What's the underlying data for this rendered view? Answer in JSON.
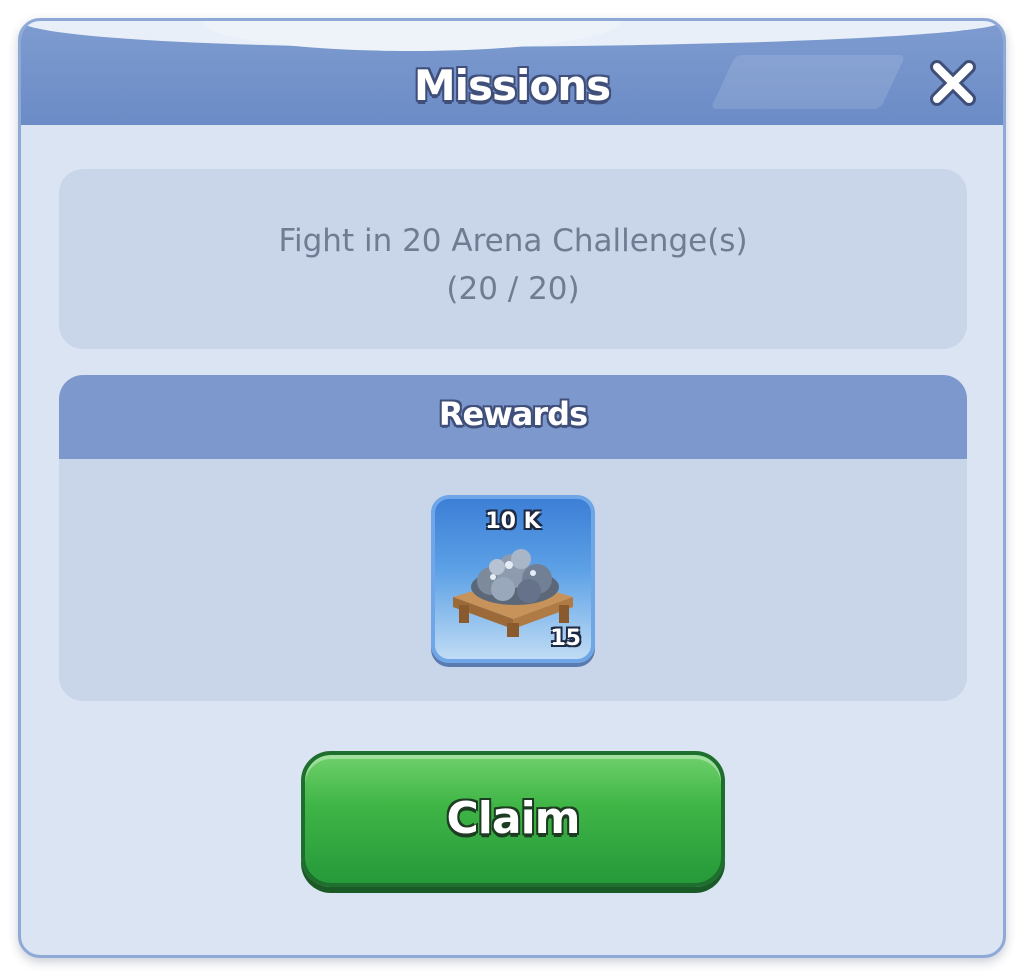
{
  "dialog": {
    "title": "Missions",
    "close_icon": "close-icon"
  },
  "mission": {
    "description": "Fight in 20 Arena Challenge(s)",
    "progress_text": "(20 / 20)",
    "progress_current": 20,
    "progress_target": 20
  },
  "rewards": {
    "title": "Rewards",
    "items": [
      {
        "amount": "10 K",
        "level": "15",
        "icon": "ore-crate-icon"
      }
    ]
  },
  "claim": {
    "label": "Claim"
  },
  "colors": {
    "header": "#6b8bc6",
    "panel": "#dbe4f2",
    "section": "#c9d5e9",
    "claim_button": "#3fb546"
  }
}
